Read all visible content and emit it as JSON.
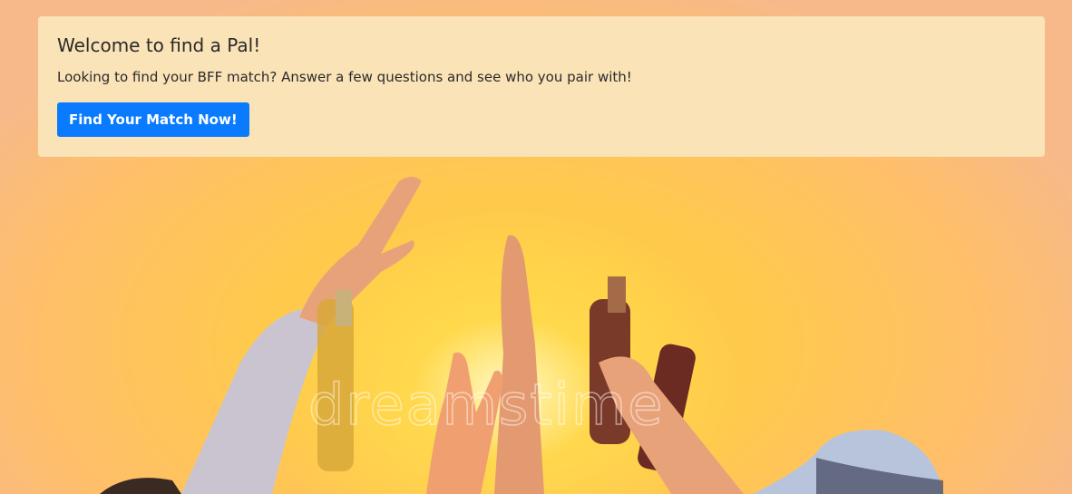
{
  "jumbotron": {
    "title": "Welcome to find a Pal!",
    "lead": "Looking to find your BFF match? Answer a few questions and see who you pair with!",
    "button_label": "Find Your Match Now!"
  },
  "background": {
    "watermark": "dreamstime",
    "accent_color": "#0a7bff",
    "panel_color": "#fbe3b8"
  }
}
